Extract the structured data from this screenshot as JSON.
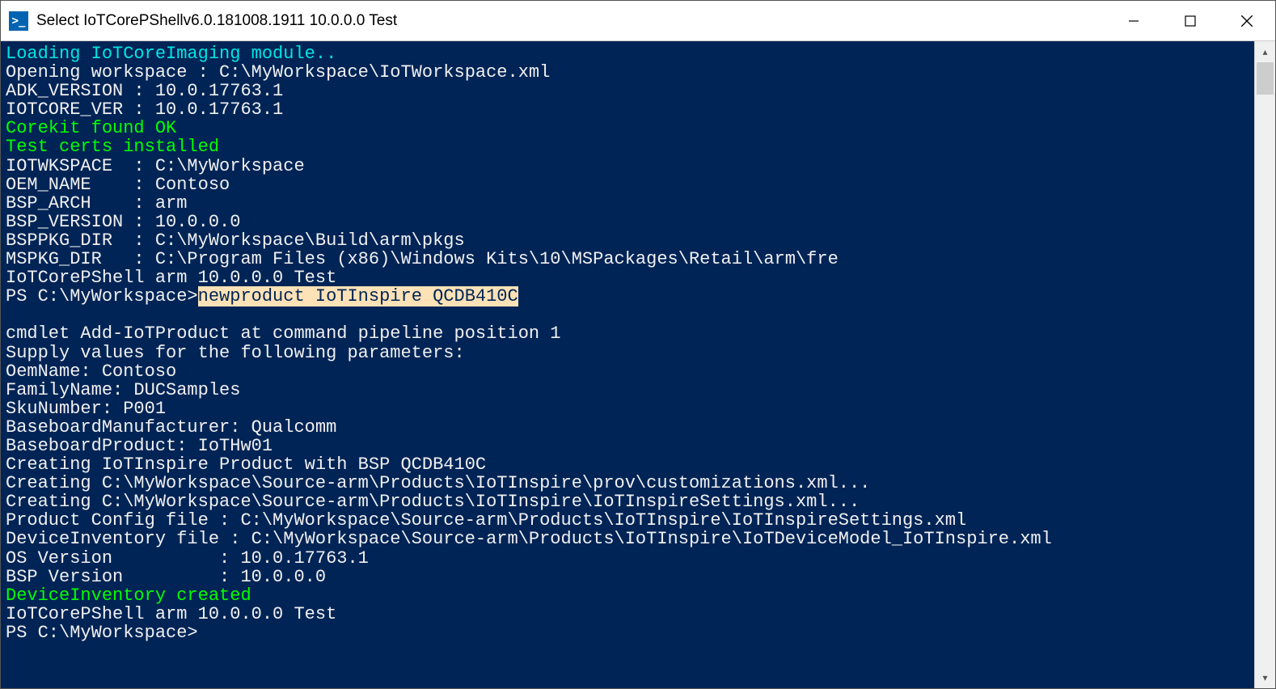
{
  "window": {
    "title": "Select IoTCorePShellv6.0.181008.1911 10.0.0.0 Test",
    "icon_glyph": ">_"
  },
  "terminal": {
    "line_loading": "Loading IoTCoreImaging module..",
    "line_opening": "Opening workspace : C:\\MyWorkspace\\IoTWorkspace.xml",
    "line_adk": "ADK_VERSION : 10.0.17763.1",
    "line_iotcore": "IOTCORE_VER : 10.0.17763.1",
    "line_corekit": "Corekit found OK",
    "line_certs": "Test certs installed",
    "line_wks": "IOTWKSPACE  : C:\\MyWorkspace",
    "line_oem": "OEM_NAME    : Contoso",
    "line_arch": "BSP_ARCH    : arm",
    "line_bspver": "BSP_VERSION : 10.0.0.0",
    "line_bsppkg": "BSPPKG_DIR  : C:\\MyWorkspace\\Build\\arm\\pkgs",
    "line_mspkg": "MSPKG_DIR   : C:\\Program Files (x86)\\Windows Kits\\10\\MSPackages\\Retail\\arm\\fre",
    "line_shell": "IoTCorePShell arm 10.0.0.0 Test",
    "prompt1_pre": "PS C:\\MyWorkspace>",
    "prompt1_cmd_a": "newproduct",
    "prompt1_cmd_b": " IoTInspire QCDB410C",
    "blank": "",
    "line_cmdlet": "cmdlet Add-IoTProduct at command pipeline position 1",
    "line_supply": "Supply values for the following parameters:",
    "line_oemname": "OemName: Contoso",
    "line_family": "FamilyName: DUCSamples",
    "line_sku": "SkuNumber: P001",
    "line_bbmfr": "BaseboardManufacturer: Qualcomm",
    "line_bbprod": "BaseboardProduct: IoTHw01",
    "line_create1": "Creating IoTInspire Product with BSP QCDB410C",
    "line_create2": "Creating C:\\MyWorkspace\\Source-arm\\Products\\IoTInspire\\prov\\customizations.xml...",
    "line_create3": "Creating C:\\MyWorkspace\\Source-arm\\Products\\IoTInspire\\IoTInspireSettings.xml...",
    "line_pcfg": "Product Config file : C:\\MyWorkspace\\Source-arm\\Products\\IoTInspire\\IoTInspireSettings.xml",
    "line_devinv": "DeviceInventory file : C:\\MyWorkspace\\Source-arm\\Products\\IoTInspire\\IoTDeviceModel_IoTInspire.xml",
    "line_osver": "OS Version          : 10.0.17763.1",
    "line_bspver2": "BSP Version         : 10.0.0.0",
    "line_devinvc": "DeviceInventory created",
    "line_shell2": "IoTCorePShell arm 10.0.0.0 Test",
    "prompt2": "PS C:\\MyWorkspace>"
  }
}
